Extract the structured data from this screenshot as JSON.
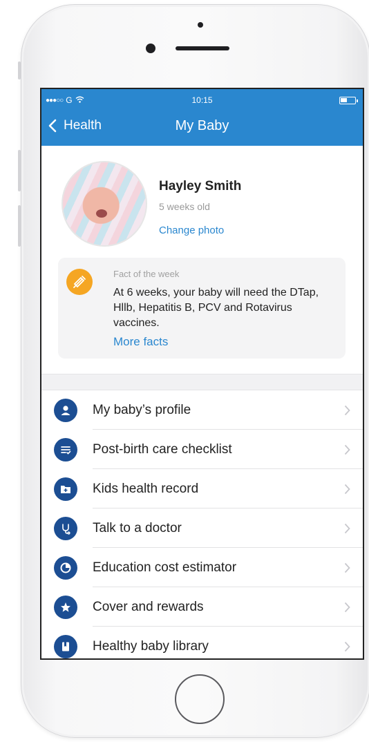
{
  "status_bar": {
    "carrier": "G",
    "time": "10:15"
  },
  "nav": {
    "back_label": "Health",
    "title": "My Baby"
  },
  "profile": {
    "name": "Hayley Smith",
    "age": "5 weeks old",
    "change_photo": "Change photo"
  },
  "fact": {
    "label": "Fact of the week",
    "text": "At 6 weeks, your baby will need the DTap, Hllb, Hepatitis B, PCV and Rotavirus vaccines.",
    "more_link": "More facts",
    "icon": "syringe-icon",
    "icon_color": "#f5a623"
  },
  "menu": {
    "items": [
      {
        "label": "My baby’s profile",
        "icon": "person-icon"
      },
      {
        "label": "Post-birth care checklist",
        "icon": "checklist-icon"
      },
      {
        "label": "Kids health record",
        "icon": "folder-plus-icon"
      },
      {
        "label": "Talk to a doctor",
        "icon": "stethoscope-icon"
      },
      {
        "label": "Education cost estimator",
        "icon": "pie-chart-icon"
      },
      {
        "label": "Cover and rewards",
        "icon": "star-icon"
      },
      {
        "label": "Healthy baby library",
        "icon": "book-icon"
      }
    ]
  },
  "colors": {
    "header": "#2a87cf",
    "menu_icon": "#1c4e93",
    "link": "#2a87cf"
  }
}
